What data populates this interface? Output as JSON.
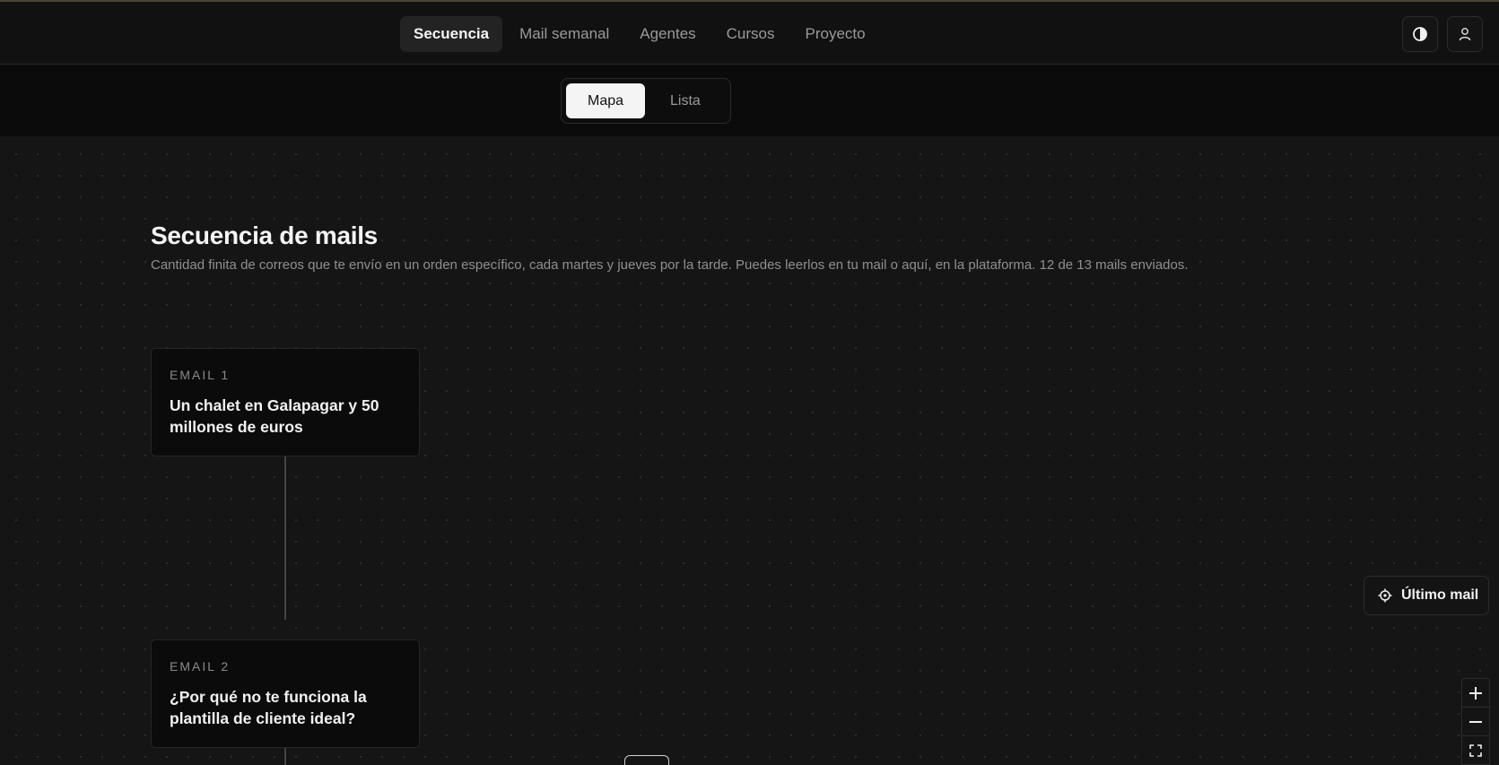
{
  "nav": {
    "items": [
      {
        "label": "Secuencia",
        "active": true
      },
      {
        "label": "Mail semanal",
        "active": false
      },
      {
        "label": "Agentes",
        "active": false
      },
      {
        "label": "Cursos",
        "active": false
      },
      {
        "label": "Proyecto",
        "active": false
      }
    ]
  },
  "header_icons": {
    "theme": "contrast-icon",
    "profile": "user-icon"
  },
  "view_toggle": {
    "options": [
      {
        "label": "Mapa",
        "active": true
      },
      {
        "label": "Lista",
        "active": false
      }
    ]
  },
  "page": {
    "title": "Secuencia de mails",
    "subtitle": "Cantidad finita de correos que te envío en un orden específico, cada martes y jueves por la tarde. Puedes leerlos en tu mail o aquí, en la plataforma. 12 de 13 mails enviados."
  },
  "emails": [
    {
      "label": "EMAIL 1",
      "title": "Un chalet en Galapagar y 50 millones de euros"
    },
    {
      "label": "EMAIL 2",
      "title": "¿Por qué no te funciona la plantilla de cliente ideal?"
    }
  ],
  "controls": {
    "last_mail_label": "Último mail",
    "last_mail_icon": "locate-icon",
    "zoom_in_icon": "plus-icon",
    "zoom_out_icon": "minus-icon",
    "fit_icon": "fullscreen-icon"
  },
  "colors": {
    "background": "#151515",
    "topbar": "#111111",
    "active_toggle": "#f4f4f4"
  }
}
